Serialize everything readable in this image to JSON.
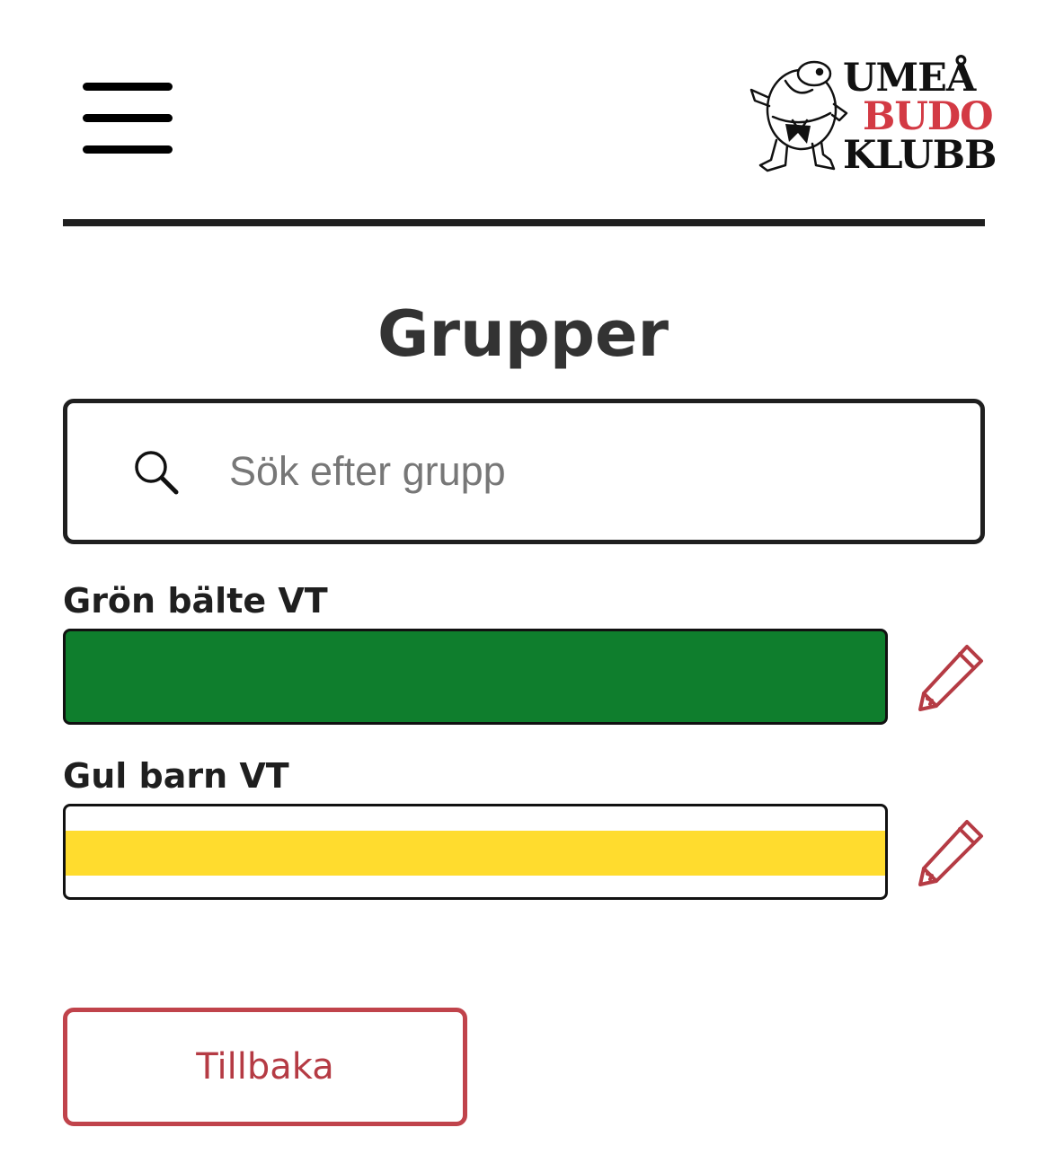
{
  "header": {
    "menu_icon": "hamburger-menu-icon",
    "logo": {
      "line1": "UMEÅ",
      "line2": "BUDO",
      "line3": "KLUBB",
      "line2_color": "#d33a44"
    }
  },
  "page": {
    "title": "Grupper"
  },
  "search": {
    "icon": "search-icon",
    "placeholder": "Sök efter grupp",
    "value": ""
  },
  "groups": [
    {
      "name": "Grön bälte VT",
      "color": "#0f7e2d",
      "bar_style": "solid",
      "edit_icon": "pencil-edit-icon"
    },
    {
      "name": "Gul barn VT",
      "color": "#ffdc2e",
      "bar_style": "stripe",
      "edit_icon": "pencil-edit-icon"
    }
  ],
  "colors": {
    "accent": "#b53b44",
    "text": "#1f1f1f",
    "title": "#333333"
  },
  "actions": {
    "back_label": "Tillbaka"
  }
}
